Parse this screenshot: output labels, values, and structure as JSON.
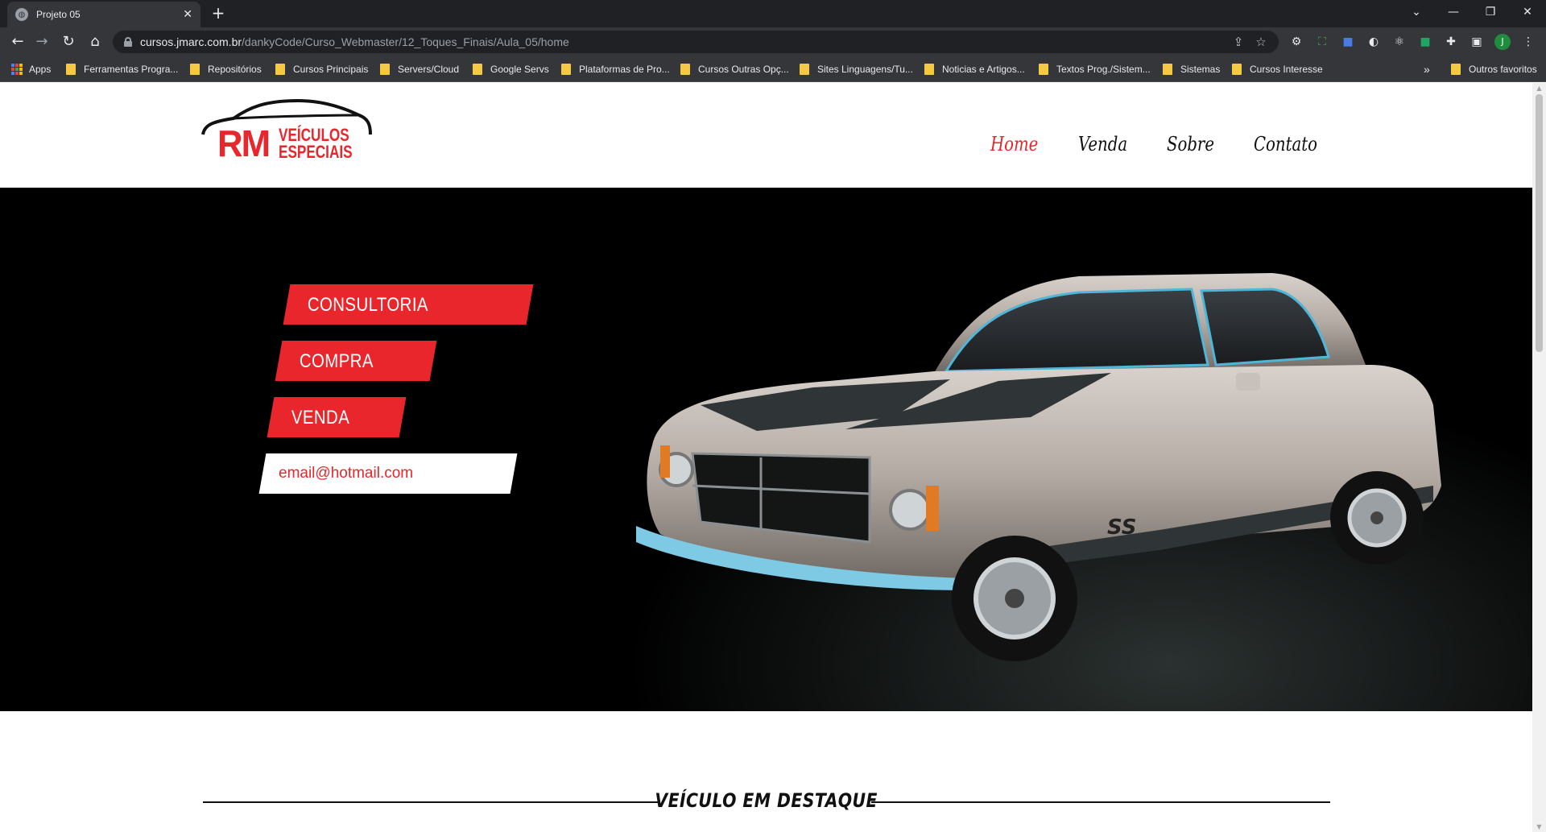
{
  "browser": {
    "tab_title": "Projeto 05",
    "url_host": "cursos.jmarc.com.br",
    "url_path": "/dankyCode/Curso_Webmaster/12_Toques_Finais/Aula_05/home",
    "profile_initial": "J",
    "bookmarks": [
      "Apps",
      "Ferramentas Progra...",
      "Repositórios",
      "Cursos Principais",
      "Servers/Cloud",
      "Google Servs",
      "Plataformas de Pro...",
      "Cursos Outras Opç...",
      "Sites Linguagens/Tu...",
      "Noticias e Artigos...",
      "Textos Prog./Sistem...",
      "Sistemas",
      "Cursos Interesse"
    ],
    "bookmarks_overflow": "»",
    "other_bookmarks": "Outros favoritos"
  },
  "site": {
    "logo": {
      "rm": "RM",
      "line1": "VEÍCULOS",
      "line2": "ESPECIAIS"
    },
    "nav": [
      "Home",
      "Venda",
      "Sobre",
      "Contato"
    ],
    "hero": {
      "buttons": [
        "CONSULTORIA",
        "COMPRA",
        "VENDA"
      ],
      "email_placeholder": "email@hotmail.com",
      "car_badge": "SS"
    },
    "featured_title": "VEÍCULO EM DESTAQUE"
  },
  "colors": {
    "accent": "#e8262b",
    "hero_bg": "#000000",
    "chrome_dark": "#202124",
    "chrome_toolbar": "#35363a"
  }
}
